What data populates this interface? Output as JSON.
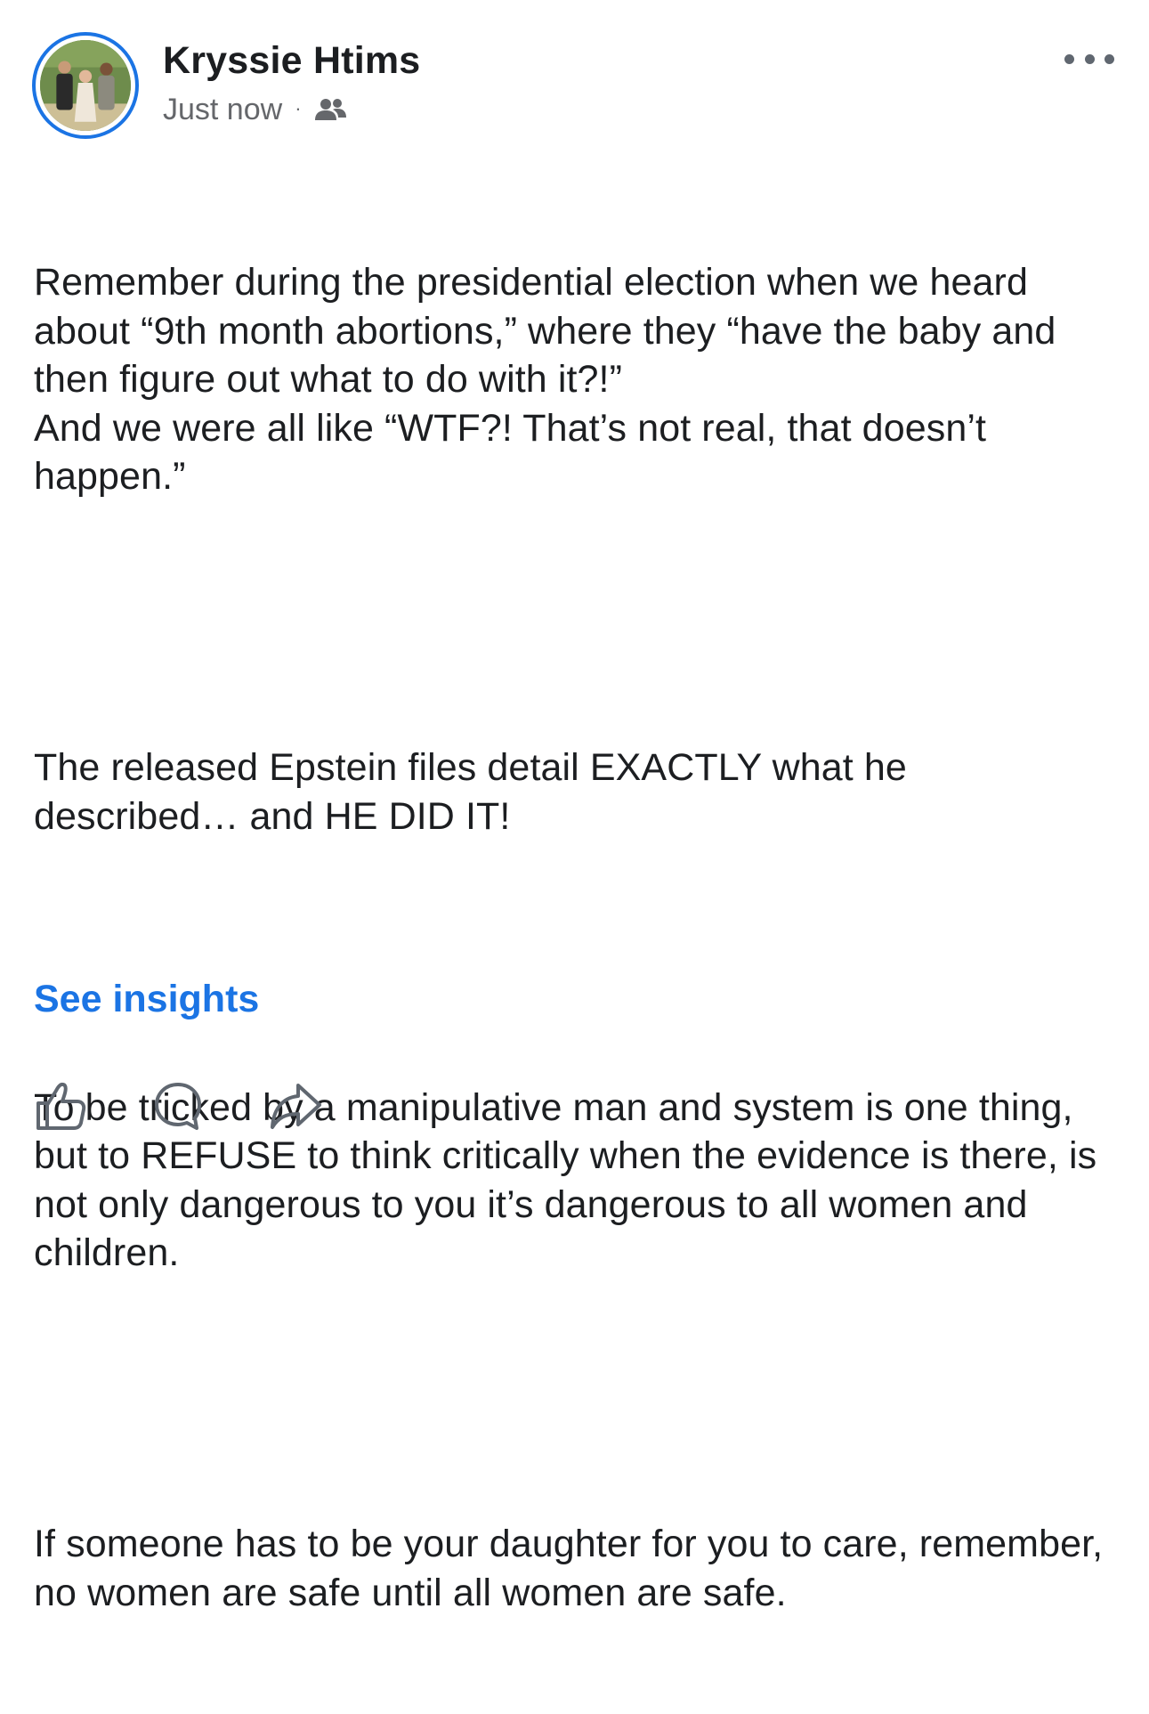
{
  "post": {
    "author": {
      "name": "Kryssie Htims",
      "avatar_icon": "profile-photo"
    },
    "timestamp": "Just now",
    "separator": "·",
    "audience_icon": "friends-icon",
    "more_icon": "more-options-icon",
    "paragraphs": [
      "Remember during the presidential election when we heard about “9th month abortions,” where they “have the baby and then figure out what to do with it?!”\nAnd we were all like “WTF?! That’s not real, that doesn’t happen.”",
      "The released Epstein files detail EXACTLY what he described… and HE DID IT!",
      "To be tricked by a manipulative man and system is one thing, but to REFUSE to think critically when the evidence is there, is not only dangerous to you it’s dangerous to all women and children.",
      "If someone has to be your daughter for you to care, remember, no women are safe until all women are safe."
    ],
    "see_insights_label": "See insights",
    "actions": [
      {
        "name": "like",
        "icon": "thumbs-up-icon"
      },
      {
        "name": "comment",
        "icon": "comment-icon"
      },
      {
        "name": "share",
        "icon": "share-icon"
      }
    ]
  },
  "colors": {
    "accent": "#1b74e4",
    "text": "#1c1e21",
    "secondary_text": "#65676b",
    "icon": "#606770"
  }
}
